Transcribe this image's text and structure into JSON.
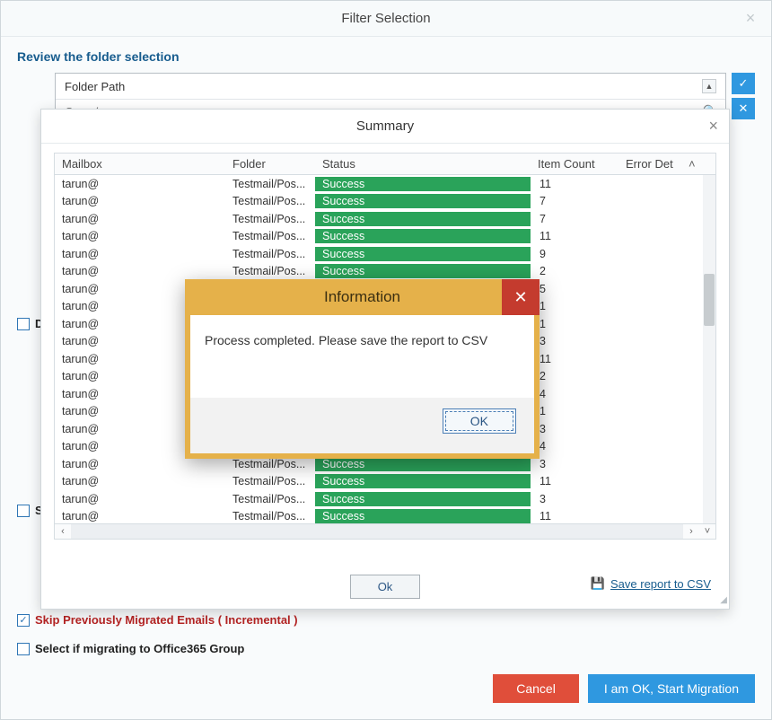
{
  "outer": {
    "title": "Filter Selection",
    "section_title": "Review the folder selection",
    "folder_path_label": "Folder Path",
    "search_placeholder": "Search..",
    "side_check": "✓",
    "side_select": "✕",
    "chk_d_letter": "D",
    "chk_s_letter": "S",
    "chk_skip_label": "Skip Previously Migrated Emails ( Incremental )",
    "chk_o365_label": "Select if migrating to Office365 Group",
    "btn_cancel": "Cancel",
    "btn_start": "I am OK, Start Migration"
  },
  "summary": {
    "title": "Summary",
    "cols": {
      "mailbox": "Mailbox",
      "folder": "Folder",
      "status": "Status",
      "item_count": "Item Count",
      "error_det": "Error Det"
    },
    "rows": [
      {
        "mailbox": "tarun@",
        "folder": "Testmail/Pos...",
        "status": "Success",
        "count": "11"
      },
      {
        "mailbox": "tarun@",
        "folder": "Testmail/Pos...",
        "status": "Success",
        "count": "7"
      },
      {
        "mailbox": "tarun@",
        "folder": "Testmail/Pos...",
        "status": "Success",
        "count": "7"
      },
      {
        "mailbox": "tarun@",
        "folder": "Testmail/Pos...",
        "status": "Success",
        "count": "11"
      },
      {
        "mailbox": "tarun@",
        "folder": "Testmail/Pos...",
        "status": "Success",
        "count": "9"
      },
      {
        "mailbox": "tarun@",
        "folder": "Testmail/Pos...",
        "status": "Success",
        "count": "2"
      },
      {
        "mailbox": "tarun@",
        "folder": "",
        "status": "",
        "count": "5"
      },
      {
        "mailbox": "tarun@",
        "folder": "",
        "status": "",
        "count": "1"
      },
      {
        "mailbox": "tarun@",
        "folder": "",
        "status": "",
        "count": "1"
      },
      {
        "mailbox": "tarun@",
        "folder": "",
        "status": "",
        "count": "3"
      },
      {
        "mailbox": "tarun@",
        "folder": "",
        "status": "",
        "count": "11"
      },
      {
        "mailbox": "tarun@",
        "folder": "",
        "status": "",
        "count": "2"
      },
      {
        "mailbox": "tarun@",
        "folder": "",
        "status": "",
        "count": "4"
      },
      {
        "mailbox": "tarun@",
        "folder": "",
        "status": "",
        "count": "1"
      },
      {
        "mailbox": "tarun@",
        "folder": "",
        "status": "",
        "count": "3"
      },
      {
        "mailbox": "tarun@",
        "folder": "",
        "status": "",
        "count": "4"
      },
      {
        "mailbox": "tarun@",
        "folder": "Testmail/Pos...",
        "status": "Success",
        "count": "3"
      },
      {
        "mailbox": "tarun@",
        "folder": "Testmail/Pos...",
        "status": "Success",
        "count": "11"
      },
      {
        "mailbox": "tarun@",
        "folder": "Testmail/Pos...",
        "status": "Success",
        "count": "3"
      },
      {
        "mailbox": "tarun@",
        "folder": "Testmail/Pos...",
        "status": "Success",
        "count": "11"
      }
    ],
    "btn_ok": "Ok",
    "save_csv": "Save report to CSV"
  },
  "info": {
    "title": "Information",
    "message": "Process completed. Please save the report to CSV",
    "btn_ok": "OK"
  }
}
